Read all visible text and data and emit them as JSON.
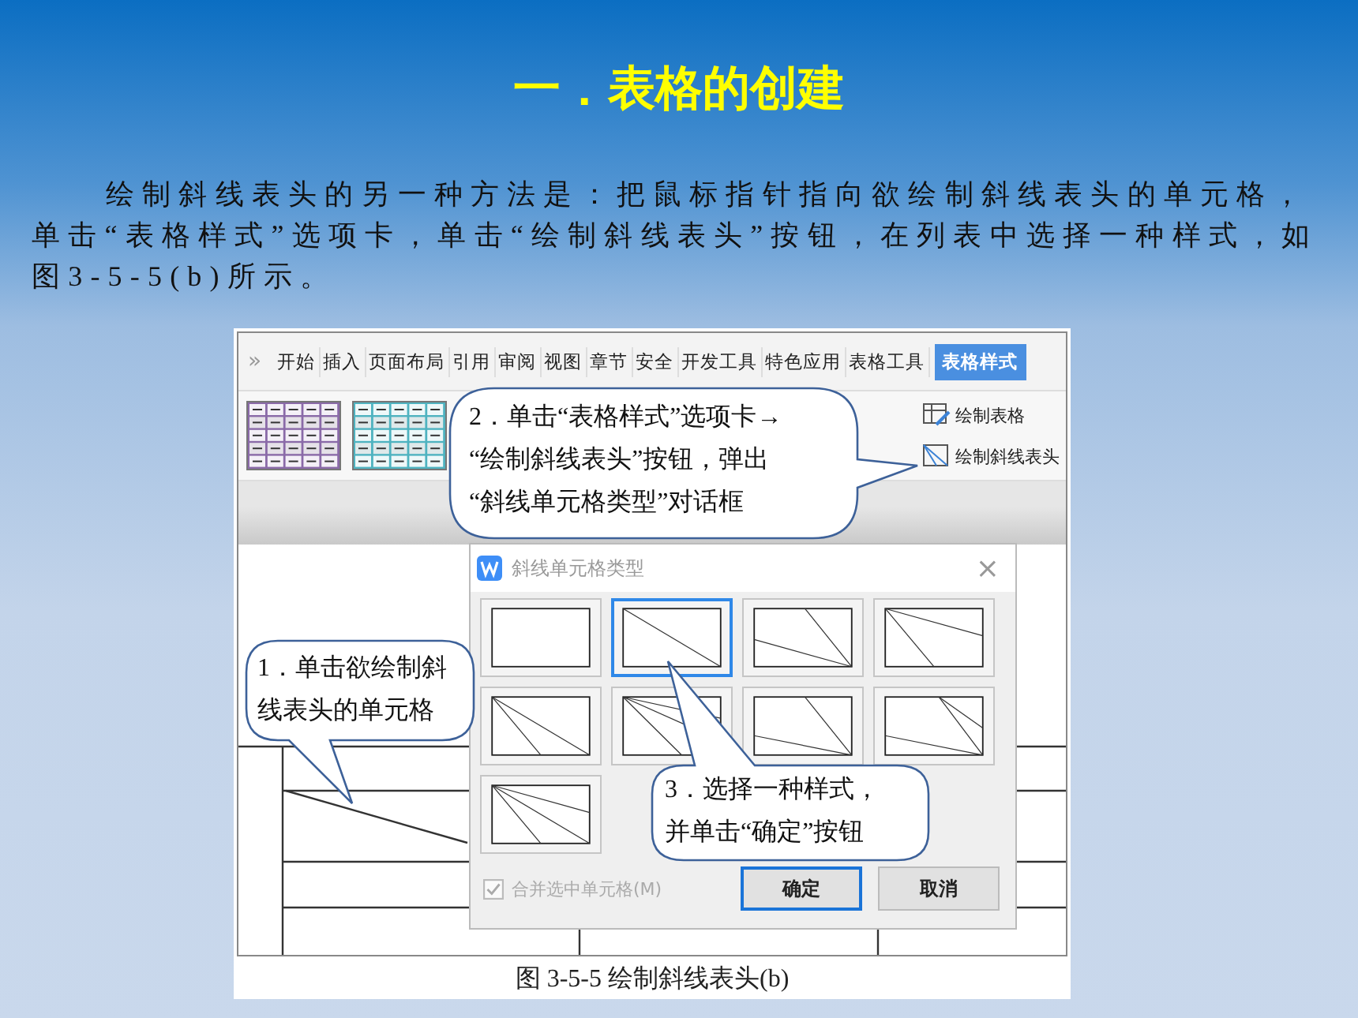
{
  "slide": {
    "title": "一．表格的创建",
    "paragraph": "绘制斜线表头的另一种方法是：把鼠标指针指向欲绘制斜线表头的单元格，单击“表格样式”选项卡，单击“绘制斜线表头”按钮，在列表中选择一种样式，如图3-5-5(b)所示。",
    "caption": "图 3-5-5 绘制斜线表头(b)"
  },
  "ribbon": {
    "overflow": "»",
    "tabs": [
      {
        "label": "开始",
        "selected": false
      },
      {
        "label": "插入",
        "selected": false
      },
      {
        "label": "页面布局",
        "selected": false
      },
      {
        "label": "引用",
        "selected": false
      },
      {
        "label": "审阅",
        "selected": false
      },
      {
        "label": "视图",
        "selected": false
      },
      {
        "label": "章节",
        "selected": false
      },
      {
        "label": "安全",
        "selected": false
      },
      {
        "label": "开发工具",
        "selected": false
      },
      {
        "label": "特色应用",
        "selected": false
      },
      {
        "label": "表格工具",
        "selected": false
      },
      {
        "label": "表格样式",
        "selected": true
      }
    ],
    "commands": [
      "绘制表格",
      "绘制斜线表头"
    ]
  },
  "dialog": {
    "title": "斜线单元格类型",
    "close": "×",
    "options": [
      {
        "selected": false
      },
      {
        "selected": true
      },
      {
        "selected": false
      },
      {
        "selected": false
      },
      {
        "selected": false
      },
      {
        "selected": false
      },
      {
        "selected": false
      },
      {
        "selected": false
      },
      {
        "selected": false
      }
    ],
    "merge_checkbox": {
      "label": "合并选中单元格(M)",
      "checked": true,
      "disabled": true
    },
    "buttons": [
      {
        "label": "确定",
        "default": true
      },
      {
        "label": "取消",
        "default": false
      }
    ]
  },
  "callouts": [
    {
      "lines": [
        "2．单击“表格样式”选项卡→",
        "“绘制斜线表头”按钮，弹出",
        "“斜线单元格类型”对话框"
      ]
    },
    {
      "lines": [
        "1．单击欲绘制斜",
        "线表头的单元格"
      ]
    },
    {
      "lines": [
        "3．选择一种样式，",
        "并单击“确定”按钮"
      ]
    }
  ]
}
